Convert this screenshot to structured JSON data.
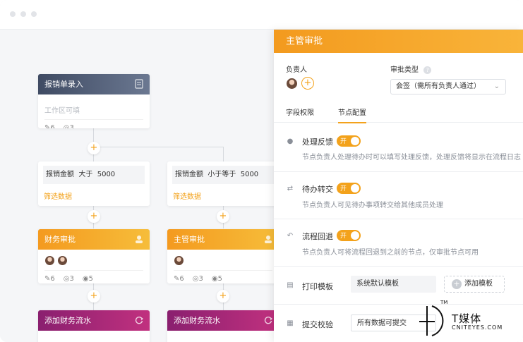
{
  "colors": {
    "accent": "#f3a21b",
    "head_dark": "#3f4b63",
    "head_orange": "#f49a1f",
    "head_purple": "#8a1f6f"
  },
  "canvas": {
    "entry_node": {
      "title": "报销单录入",
      "placeholder": "工作区可填",
      "stat_edit": "6",
      "stat_view": "3"
    },
    "cond_left": {
      "label": "报销金额",
      "op": "大于",
      "value": "5000",
      "link": "筛选数据"
    },
    "cond_right": {
      "label": "报销金额",
      "op": "小于等于",
      "value": "5000",
      "link": "筛选数据"
    },
    "finance_node": {
      "title": "财务审批",
      "stat_edit": "6",
      "stat_view": "3",
      "stat_eye": "5"
    },
    "manager_node": {
      "title": "主管审批",
      "stat_edit": "6",
      "stat_view": "3",
      "stat_eye": "5"
    },
    "flow_left": {
      "title": "添加财务流水"
    },
    "flow_right": {
      "title": "添加财务流水"
    },
    "plus": "+"
  },
  "panel": {
    "title": "主管审批",
    "owner_label": "负责人",
    "approval_type_label": "审批类型",
    "help": "?",
    "approval_type_value": "会签（需所有负责人通过）",
    "tabs": [
      "字段权限",
      "节点配置"
    ],
    "toggle_on": "开",
    "feedback": {
      "title": "处理反馈",
      "desc": "节点负责人处理待办时可以填写处理反馈，处理反馈将显示在流程日志"
    },
    "transfer": {
      "title": "待办转交",
      "desc": "节点负责人可见待办事项转交给其他成员处理"
    },
    "rollback": {
      "title": "流程回退",
      "desc": "节点负责人可将流程回退到之前的节点，仅审批节点可用"
    },
    "print": {
      "title": "打印模板",
      "value": "系统默认模板",
      "add": "添加模板"
    },
    "submit": {
      "title": "提交校验",
      "value": "所有数据可提交"
    }
  },
  "watermark": {
    "brand": "T媒体",
    "sub": "CNITEYES.COM",
    "tm": "TM"
  }
}
